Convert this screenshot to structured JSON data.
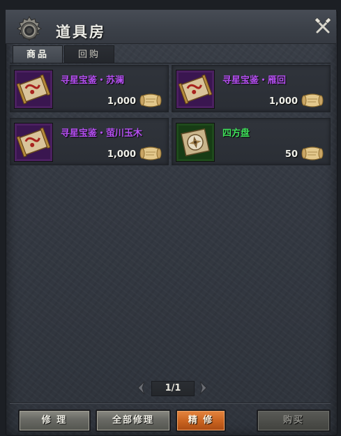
{
  "window": {
    "title": "道具房",
    "gear_icon": "gear-icon",
    "close_icon": "crossed-tools-close-icon"
  },
  "tabs": [
    {
      "label": "商品",
      "active": true
    },
    {
      "label": "回购",
      "active": false
    }
  ],
  "items": [
    {
      "name": "寻星宝鉴・苏澜",
      "price": "1,000",
      "name_color": "#b44ff0",
      "icon": "star-treasure-scroll-icon",
      "currency_icon": "scroll-currency-icon"
    },
    {
      "name": "寻星宝鉴・雁回",
      "price": "1,000",
      "name_color": "#b44ff0",
      "icon": "star-treasure-scroll-icon",
      "currency_icon": "scroll-currency-icon"
    },
    {
      "name": "寻星宝鉴・萤川玉木",
      "price": "1,000",
      "name_color": "#b44ff0",
      "icon": "star-treasure-scroll-icon",
      "currency_icon": "scroll-currency-icon"
    },
    {
      "name": "四方盘",
      "price": "50",
      "name_color": "#3fe05a",
      "icon": "compass-disk-icon",
      "currency_icon": "scroll-currency-icon"
    }
  ],
  "pager": {
    "text": "1/1",
    "prev_icon": "chevron-left-icon",
    "next_icon": "chevron-right-icon"
  },
  "buttons": {
    "repair": "修 理",
    "repair_all": "全部修理",
    "fine_repair": "精 修",
    "buy": "购买"
  },
  "colors": {
    "rare_item": "#b44ff0",
    "common_item": "#3fe05a",
    "accent_button": "#c8621f"
  }
}
